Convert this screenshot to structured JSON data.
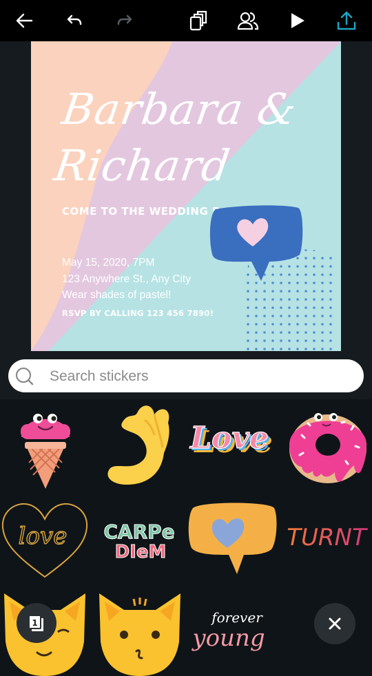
{
  "toolbar": {
    "icons": [
      "back-arrow-icon",
      "undo-icon",
      "redo-icon",
      "layers-copy-icon",
      "collaborators-icon",
      "play-icon",
      "share-upload-icon"
    ],
    "accent": "#1ea7c4"
  },
  "design": {
    "name_line1": "Barbara &",
    "name_line2": "Richard",
    "headline": "COME TO THE WEDDING P",
    "detail_lines": [
      "May 15, 2020, 7PM",
      "123 Anywhere St., Any City",
      "Wear shades of pastel!"
    ],
    "rsvp": "RSVP BY CALLING 123 456 7890!",
    "colors": {
      "peach": "#fbd2bd",
      "lilac": "#e3c7df",
      "mint": "#b6e2e4",
      "blue": "#3a6ebf"
    }
  },
  "search": {
    "placeholder": "Search stickers",
    "value": ""
  },
  "stickers": [
    {
      "name": "ice-cream-sticker"
    },
    {
      "name": "hand-sticker"
    },
    {
      "name": "love-word-sticker",
      "text": "Love"
    },
    {
      "name": "donut-sticker"
    },
    {
      "name": "love-heart-outline-sticker",
      "text": "love"
    },
    {
      "name": "carpe-diem-sticker",
      "text_line1": "CARPe",
      "text_line2": "DIeM"
    },
    {
      "name": "heart-speech-bubble-sticker"
    },
    {
      "name": "turnt-sticker",
      "text": "TURNT"
    },
    {
      "name": "cat-wink-sticker"
    },
    {
      "name": "cat-kiss-sticker"
    },
    {
      "name": "forever-young-sticker",
      "text_line1": "forever",
      "text_line2": "young"
    }
  ],
  "pages": {
    "count": "1"
  },
  "close": {
    "icon": "close-icon"
  }
}
